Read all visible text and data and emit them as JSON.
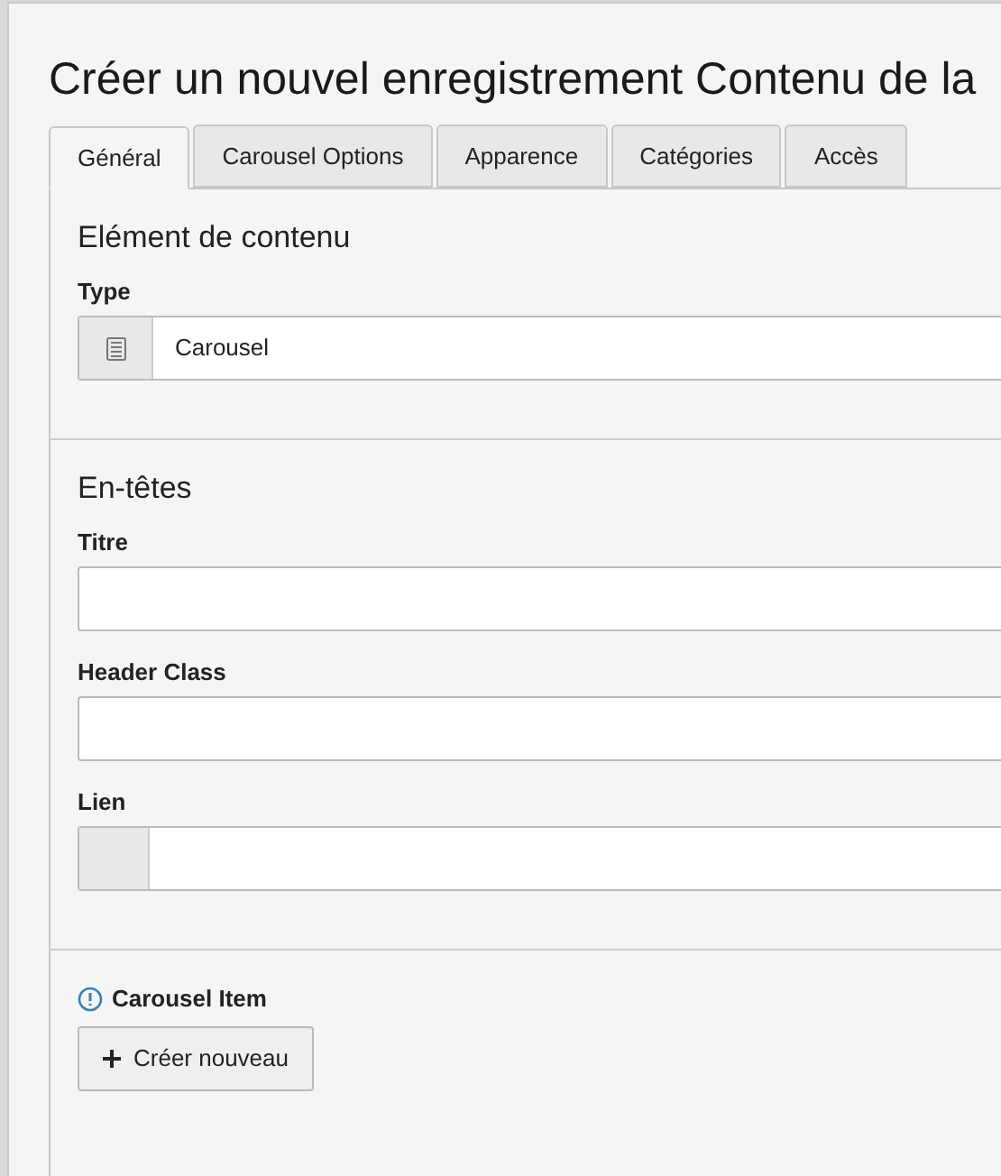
{
  "title": "Créer un nouvel enregistrement Contenu de la",
  "tabs": [
    {
      "label": "Général",
      "selected": true
    },
    {
      "label": "Carousel Options",
      "selected": false
    },
    {
      "label": "Apparence",
      "selected": false
    },
    {
      "label": "Catégories",
      "selected": false
    },
    {
      "label": "Accès",
      "selected": false
    }
  ],
  "sections": [
    {
      "heading": "Elément de contenu",
      "fields": [
        {
          "label": "Type",
          "kind": "select",
          "value": "Carousel"
        }
      ]
    },
    {
      "heading": "En-têtes",
      "fields": [
        {
          "label": "Titre",
          "kind": "text"
        },
        {
          "label": "Header Class",
          "kind": "text"
        },
        {
          "label": "Lien",
          "kind": "link"
        }
      ]
    }
  ],
  "inline": {
    "label": "Carousel Item",
    "button": "Créer nouveau"
  }
}
